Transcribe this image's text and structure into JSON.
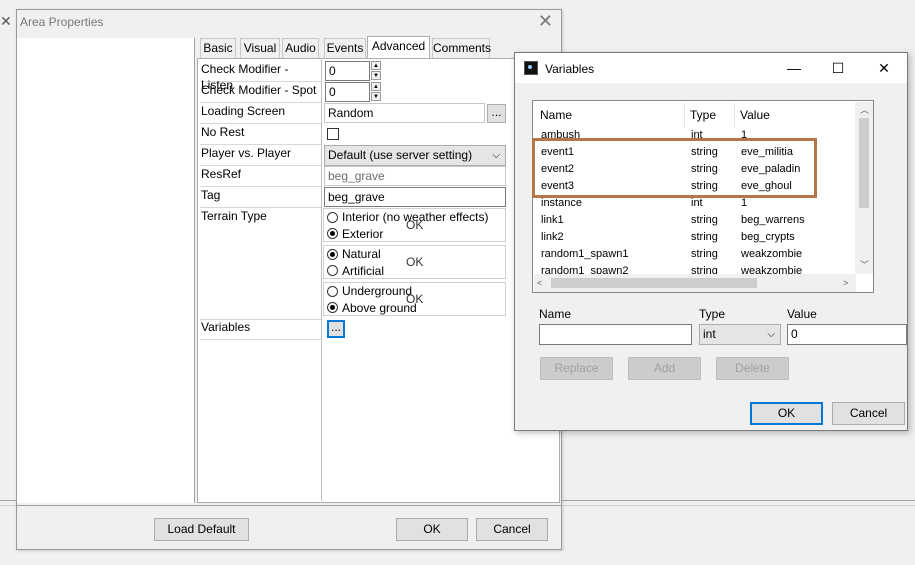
{
  "background": {
    "close_glyph": "✕"
  },
  "area_dialog": {
    "title": "Area Properties",
    "close_glyph": "✕",
    "tabs": [
      "Basic",
      "Visual",
      "Audio",
      "Events",
      "Advanced",
      "Comments"
    ],
    "properties": {
      "check_listen": {
        "label": "Check Modifier - Listen",
        "value": "0"
      },
      "check_spot": {
        "label": "Check Modifier - Spot",
        "value": "0"
      },
      "loading_screen": {
        "label": "Loading Screen",
        "value": "Random",
        "button": "..."
      },
      "no_rest": {
        "label": "No Rest"
      },
      "pvp": {
        "label": "Player vs. Player",
        "value": "Default (use server setting)"
      },
      "resref": {
        "label": "ResRef",
        "value": "beg_grave"
      },
      "tag": {
        "label": "Tag",
        "value": "beg_grave"
      },
      "terrain": {
        "label": "Terrain Type"
      },
      "variables": {
        "label": "Variables",
        "button": "..."
      }
    },
    "terrain_groups": {
      "g1": {
        "opt1": "Interior (no weather effects)",
        "opt2": "Exterior",
        "ok": "OK"
      },
      "g2": {
        "opt1": "Natural",
        "opt2": "Artificial",
        "ok": "OK"
      },
      "g3": {
        "opt1": "Underground",
        "opt2": "Above ground",
        "ok": "OK"
      }
    },
    "buttons": {
      "load_default": "Load Default",
      "ok": "OK",
      "cancel": "Cancel"
    }
  },
  "vars_dialog": {
    "title": "Variables",
    "controls": {
      "minimize": "—",
      "maximize": "☐",
      "close": "✕"
    },
    "columns": [
      "Name",
      "Type",
      "Value"
    ],
    "rows": [
      {
        "name": "ambush",
        "type": "int",
        "value": "1"
      },
      {
        "name": "event1",
        "type": "string",
        "value": "eve_militia"
      },
      {
        "name": "event2",
        "type": "string",
        "value": "eve_paladin"
      },
      {
        "name": "event3",
        "type": "string",
        "value": "eve_ghoul"
      },
      {
        "name": "instance",
        "type": "int",
        "value": "1"
      },
      {
        "name": "link1",
        "type": "string",
        "value": "beg_warrens"
      },
      {
        "name": "link2",
        "type": "string",
        "value": "beg_crypts"
      },
      {
        "name": "random1_spawn1",
        "type": "string",
        "value": "weakzombie"
      },
      {
        "name": "random1_spawn2",
        "type": "string",
        "value": "weakzombie"
      }
    ],
    "form": {
      "name_label": "Name",
      "name_value": "",
      "type_label": "Type",
      "type_value": "int",
      "value_label": "Value",
      "value_value": "0"
    },
    "buttons": {
      "replace": "Replace",
      "add": "Add",
      "delete": "Delete",
      "ok": "OK",
      "cancel": "Cancel"
    },
    "highlight_color": "#b5764b"
  }
}
